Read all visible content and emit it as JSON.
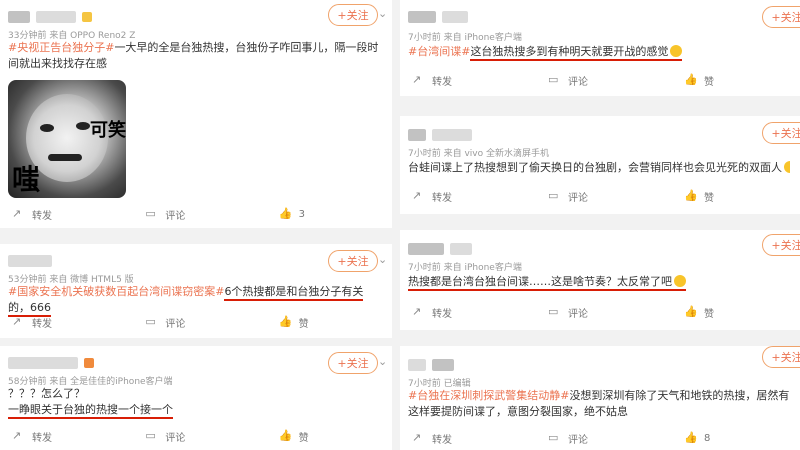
{
  "follow_label": "+关注",
  "actions": {
    "repost": "转发",
    "comment": "评论",
    "like": "赞"
  },
  "left_posts": [
    {
      "meta": "33分钟前 来自 OPPO Reno2 Z",
      "hashtag": "#央视正告台独分子#",
      "text": "一大早的全是台独热搜，台独份子咋回事儿，隔一段时间就出来找找存在感",
      "meme_text_1": "可笑",
      "meme_text_2": "嗤",
      "likes": "3"
    },
    {
      "meta": "53分钟前 来自 微博 HTML5 版",
      "hashtag": "#国家安全机关破获数百起台湾间谍窃密案#",
      "text": "6个热搜都是和台独分子有关的，666",
      "likes": ""
    },
    {
      "meta": "58分钟前 来自 全是佳佳的iPhone客户端",
      "text1": "？？？怎么了？",
      "text2": "一睁眼关于台独的热搜一个接一个",
      "likes": ""
    }
  ],
  "right_posts": [
    {
      "meta": "7小时前 来自 iPhone客户端",
      "hashtag": "#台湾间谍#",
      "text": "这台独热搜多到有种明天就要开战的感觉",
      "likes": ""
    },
    {
      "meta": "7小时前 来自 vivo 全新水滴屏手机",
      "text": "台蛙间谍上了热搜想到了偷天换日的台独剧，会营销同样也会见光死的双面人",
      "likes": ""
    },
    {
      "meta": "7小时前 来自 iPhone客户端",
      "text": "热搜都是台湾台独台间谍……这是啥节奏？太反常了吧",
      "likes": ""
    },
    {
      "meta": "7小时前   已编辑",
      "hashtag": "#台独在深圳刺探武警集结动静#",
      "text": "没想到深圳有除了天气和地铁的热搜，居然有这样要提防间谍了，意图分裂国家，绝不姑息",
      "likes": "8"
    }
  ]
}
